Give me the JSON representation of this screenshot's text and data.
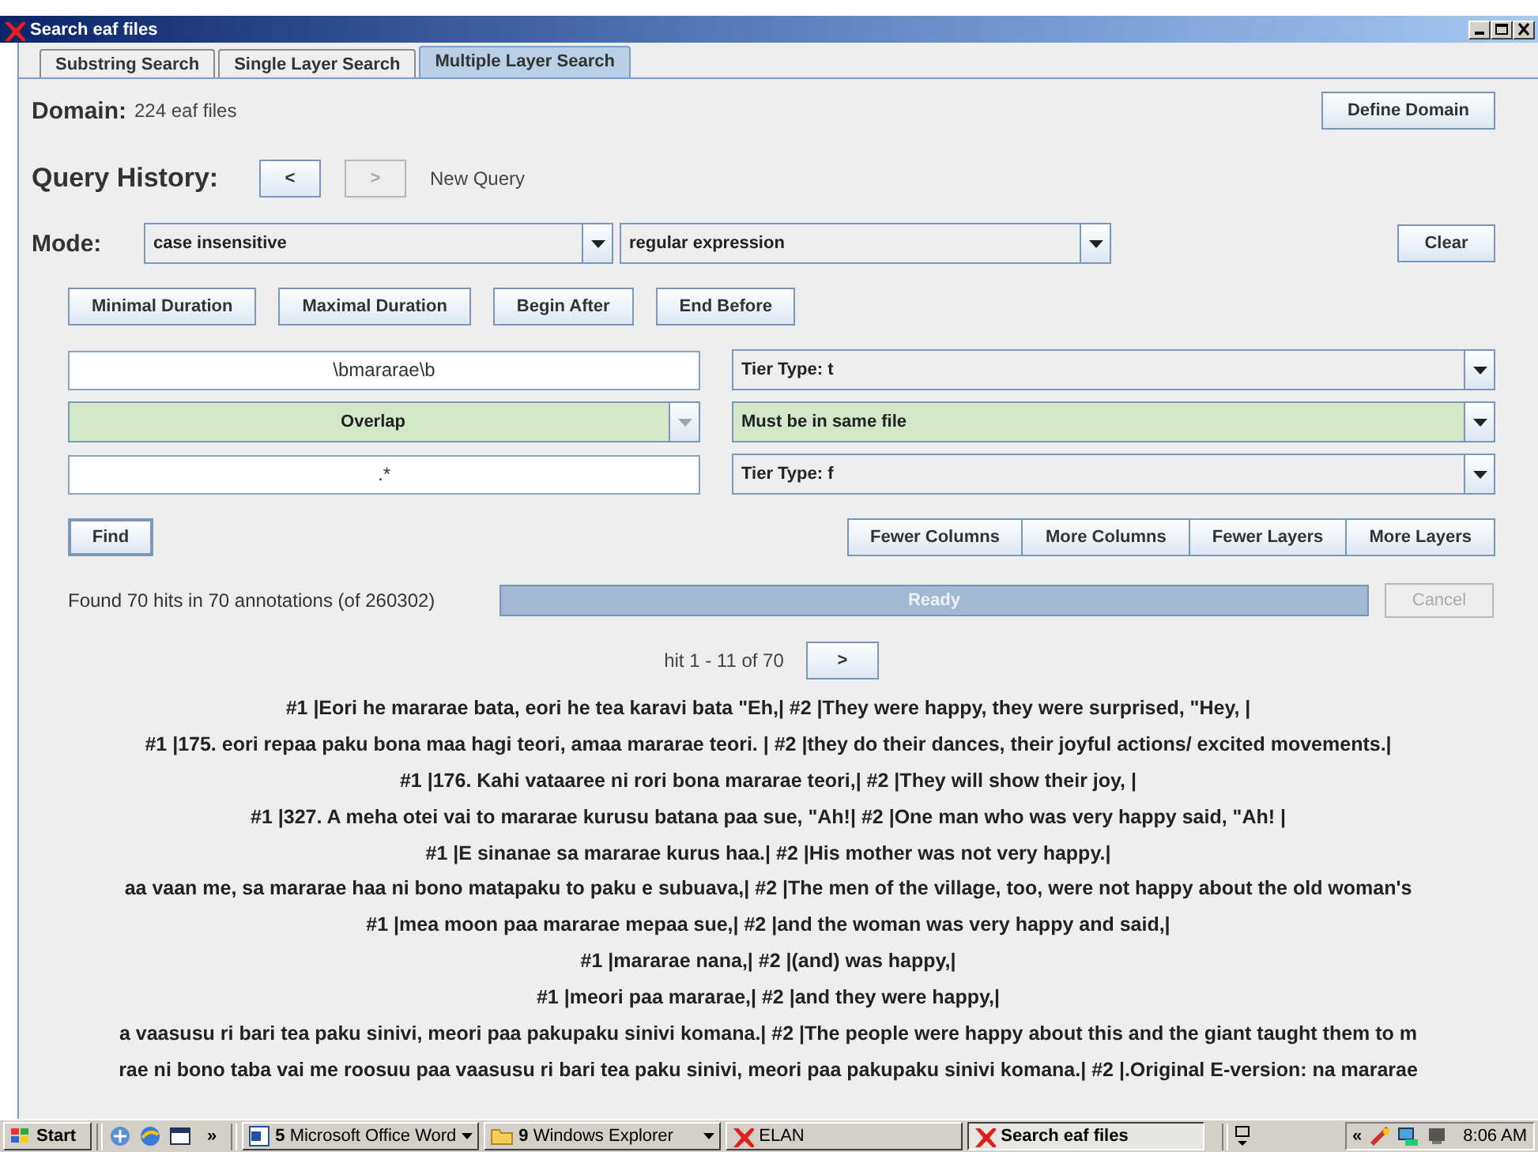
{
  "window": {
    "title": "Search eaf files"
  },
  "tabs": [
    {
      "label": "Substring Search",
      "selected": false
    },
    {
      "label": "Single Layer Search",
      "selected": false
    },
    {
      "label": "Multiple Layer Search",
      "selected": true
    }
  ],
  "domain": {
    "label": "Domain:",
    "value": "224 eaf files",
    "button": "Define Domain"
  },
  "query_history": {
    "label": "Query History:",
    "back": {
      "label": "<",
      "disabled": false
    },
    "forward": {
      "label": ">",
      "disabled": true
    },
    "status": "New Query"
  },
  "mode": {
    "label": "Mode:",
    "case": "case insensitive",
    "match": "regular expression",
    "clear": "Clear"
  },
  "constraint_buttons": [
    "Minimal Duration",
    "Maximal Duration",
    "Begin After",
    "End Before"
  ],
  "layers": [
    {
      "kind": "pattern",
      "value": "\\bmararae\\b",
      "tier": "Tier Type: t"
    },
    {
      "kind": "relation",
      "value": "Overlap",
      "tier": "Must be in same file"
    },
    {
      "kind": "pattern",
      "value": ".*",
      "tier": "Tier Type: f"
    }
  ],
  "find": "Find",
  "column_buttons": [
    "Fewer Columns",
    "More Columns",
    "Fewer Layers",
    "More Layers"
  ],
  "status": {
    "text": "Found 70 hits in 70 annotations (of 260302)",
    "progress": "Ready",
    "level": 1,
    "cancel": {
      "label": "Cancel",
      "disabled": true
    }
  },
  "pager": {
    "label": "hit 1 - 11 of 70",
    "next": ">"
  },
  "hits": [
    "#1 |Eori he mararae bata, eori he tea karavi bata \"Eh,|  #2 |They were happy, they were surprised, \"Hey, |",
    "#1 |175. eori repaa paku bona maa hagi teori, amaa mararae teori. |  #2 |they do their dances, their joyful actions/ excited movements.|",
    "#1 |176. Kahi vataaree ni rori bona mararae teori,|  #2 |They will show their joy, |",
    "#1 |327. A meha otei vai to mararae kurusu batana paa sue, \"Ah!|  #2 |One man who was very happy said, \"Ah! |",
    "#1 |E sinanae sa mararae kurus haa.|  #2 |His mother was not very happy.|",
    "aa vaan me, sa mararae haa ni bono matapaku to paku e subuava,|  #2 |The men of the village, too, were not happy about the old woman's",
    "#1 |mea moon paa mararae mepaa sue,|  #2 |and the woman was very happy and said,|",
    "#1 |mararae nana,|  #2 |(and) was happy,|",
    "#1 |meori paa mararae,|  #2 |and they were happy,|",
    "a vaasusu ri bari tea paku sinivi, meori paa pakupaku sinivi komana.|  #2 |The people were happy about this and the giant taught them to m",
    "rae ni bono taba vai me roosuu paa vaasusu ri bari tea paku sinivi, meori paa pakupaku sinivi komana.|  #2 |.Original E-version: na mararae"
  ],
  "taskbar": {
    "start": "Start",
    "more": "»",
    "tasks": [
      {
        "kind": "group",
        "count": "5",
        "label": "Microsoft Office Word",
        "selected": false
      },
      {
        "kind": "folder",
        "count": "9",
        "label": "Windows Explorer",
        "selected": false
      },
      {
        "kind": "app",
        "label": "ELAN",
        "selected": false
      },
      {
        "kind": "app",
        "label": "Search eaf files",
        "selected": true
      }
    ],
    "tray_more": "«",
    "time": "8:06 AM"
  }
}
